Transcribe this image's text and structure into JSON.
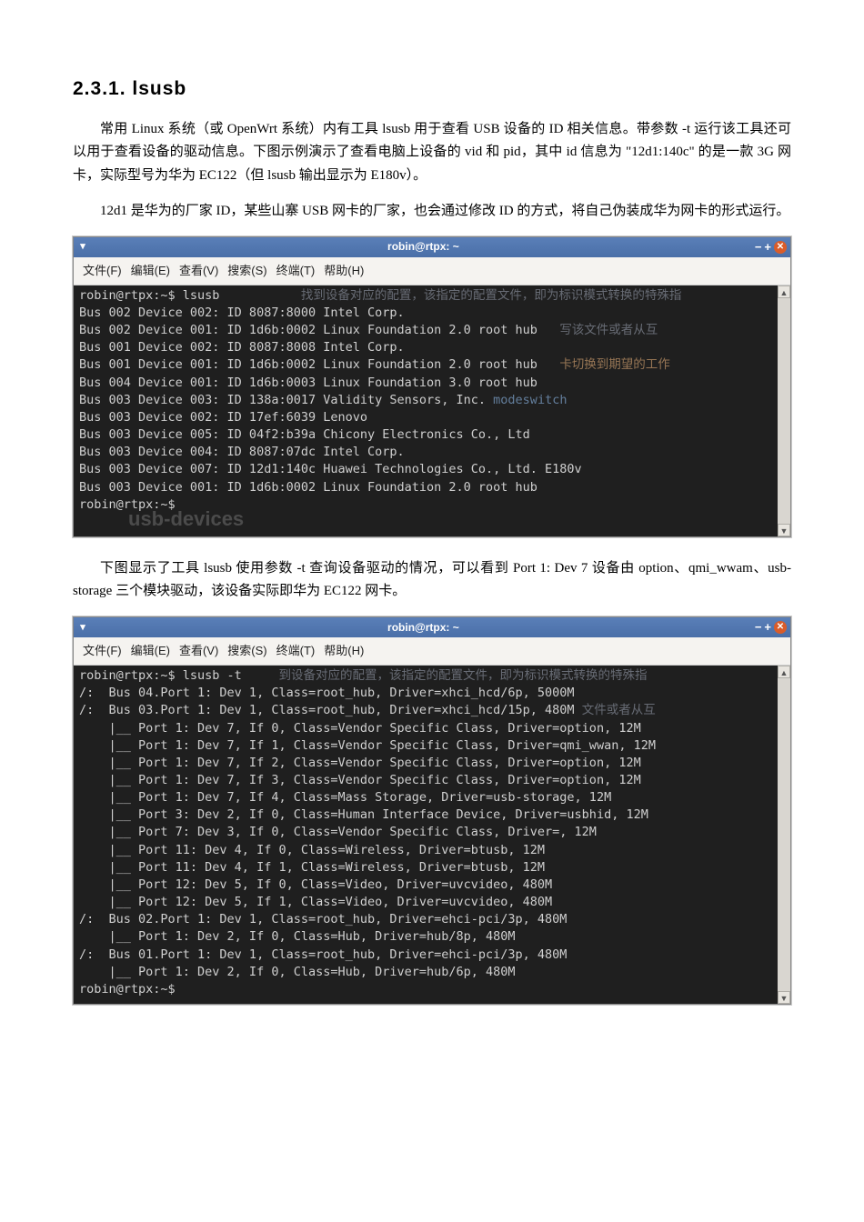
{
  "heading": "2.3.1.  lsusb",
  "para1": "常用 Linux 系统（或 OpenWrt 系统）内有工具 lsusb 用于查看 USB 设备的 ID 相关信息。带参数 -t 运行该工具还可以用于查看设备的驱动信息。下图示例演示了查看电脑上设备的 vid 和 pid，其中 id 信息为 \"12d1:140c\" 的是一款 3G 网卡，实际型号为华为 EC122（但 lsusb 输出显示为 E180v）。",
  "para2": "12d1 是华为的厂家 ID，某些山寨 USB 网卡的厂家，也会通过修改 ID 的方式，将自己伪装成华为网卡的形式运行。",
  "para3": "下图显示了工具 lsusb 使用参数 -t 查询设备驱动的情况，可以看到 Port 1: Dev 7 设备由 option、qmi_wwam、usb-storage 三个模块驱动，该设备实际即华为 EC122 网卡。",
  "window": {
    "title": "robin@rtpx: ~",
    "menu": {
      "file": "文件(F)",
      "edit": "编辑(E)",
      "view": "查看(V)",
      "search": "搜索(S)",
      "terminal": "终端(T)",
      "help": "帮助(H)"
    },
    "controls": {
      "min": "−",
      "max": "+",
      "close": "✕"
    }
  },
  "term1": {
    "prompt1": "robin@rtpx:~$ lsusb",
    "lines": [
      "Bus 002 Device 002: ID 8087:8000 Intel Corp.",
      "Bus 002 Device 001: ID 1d6b:0002 Linux Foundation 2.0 root hub",
      "Bus 001 Device 002: ID 8087:8008 Intel Corp.",
      "Bus 001 Device 001: ID 1d6b:0002 Linux Foundation 2.0 root hub",
      "Bus 004 Device 001: ID 1d6b:0003 Linux Foundation 3.0 root hub",
      "Bus 003 Device 003: ID 138a:0017 Validity Sensors, Inc.",
      "Bus 003 Device 002: ID 17ef:6039 Lenovo",
      "Bus 003 Device 005: ID 04f2:b39a Chicony Electronics Co., Ltd",
      "Bus 003 Device 004: ID 8087:07dc Intel Corp.",
      "Bus 003 Device 007: ID 12d1:140c Huawei Technologies Co., Ltd. E180v",
      "Bus 003 Device 001: ID 1d6b:0002 Linux Foundation 2.0 root hub"
    ],
    "prompt2": "robin@rtpx:~$",
    "ghost1_a": "找到设备对应的配置，该指定的配置文件，即为标识模式转换的特殊指",
    "ghost1_b": "写该文件或者从互",
    "ghost1_c": "卡切换到期望的工作",
    "ghost_modeswitch": "modeswitch",
    "ghost_big": "usb-devices"
  },
  "term2": {
    "prompt1": "robin@rtpx:~$ lsusb -t",
    "lines": [
      "/:  Bus 04.Port 1: Dev 1, Class=root_hub, Driver=xhci_hcd/6p, 5000M",
      "/:  Bus 03.Port 1: Dev 1, Class=root_hub, Driver=xhci_hcd/15p, 480M",
      "    |__ Port 1: Dev 7, If 0, Class=Vendor Specific Class, Driver=option, 12M",
      "    |__ Port 1: Dev 7, If 1, Class=Vendor Specific Class, Driver=qmi_wwan, 12M",
      "    |__ Port 1: Dev 7, If 2, Class=Vendor Specific Class, Driver=option, 12M",
      "    |__ Port 1: Dev 7, If 3, Class=Vendor Specific Class, Driver=option, 12M",
      "    |__ Port 1: Dev 7, If 4, Class=Mass Storage, Driver=usb-storage, 12M",
      "    |__ Port 3: Dev 2, If 0, Class=Human Interface Device, Driver=usbhid, 12M",
      "    |__ Port 7: Dev 3, If 0, Class=Vendor Specific Class, Driver=, 12M",
      "    |__ Port 11: Dev 4, If 0, Class=Wireless, Driver=btusb, 12M",
      "    |__ Port 11: Dev 4, If 1, Class=Wireless, Driver=btusb, 12M",
      "    |__ Port 12: Dev 5, If 0, Class=Video, Driver=uvcvideo, 480M",
      "    |__ Port 12: Dev 5, If 1, Class=Video, Driver=uvcvideo, 480M",
      "/:  Bus 02.Port 1: Dev 1, Class=root_hub, Driver=ehci-pci/3p, 480M",
      "    |__ Port 1: Dev 2, If 0, Class=Hub, Driver=hub/8p, 480M",
      "/:  Bus 01.Port 1: Dev 1, Class=root_hub, Driver=ehci-pci/3p, 480M",
      "    |__ Port 1: Dev 2, If 0, Class=Hub, Driver=hub/6p, 480M"
    ],
    "prompt2": "robin@rtpx:~$",
    "ghost2_a": "到设备对应的配置，该指定的配置文件，即为标识模式转换的特殊指",
    "ghost2_b": "文件或者从互"
  }
}
